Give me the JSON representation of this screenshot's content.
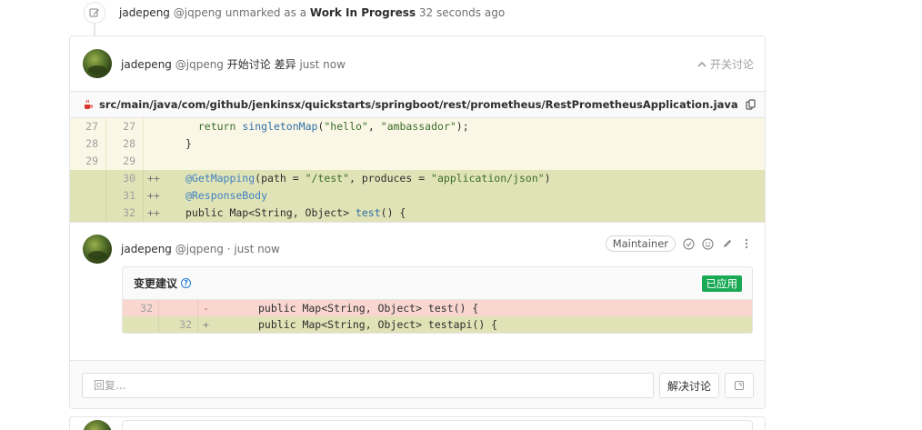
{
  "system_note": {
    "author": "jadepeng",
    "username": "@jqpeng",
    "action": "unmarked as a",
    "status": "Work In Progress",
    "time": "32 seconds ago",
    "icon": "pencil-square-icon"
  },
  "discussion": {
    "author": "jadepeng",
    "username": "@jqpeng",
    "action": "开始讨论",
    "link": "差异",
    "time": "just now",
    "toggle_label": "开关讨论",
    "file_path": "src/main/java/com/github/jenkinsx/quickstarts/springboot/rest/prometheus/RestPrometheusApplication.java",
    "diff_lines": [
      {
        "old": "27",
        "new": "27",
        "marker": "",
        "type": "context",
        "indent": "  ",
        "kw": "return",
        "fn": "singletonMap",
        "open": "(",
        "s1": "\"hello\"",
        "mid": ", ",
        "s2": "\"ambassador\"",
        "close": ");"
      },
      {
        "old": "28",
        "new": "28",
        "marker": "",
        "type": "context",
        "text": "}"
      },
      {
        "old": "29",
        "new": "29",
        "marker": "",
        "type": "context",
        "text": ""
      },
      {
        "old": "",
        "new": "30",
        "marker": "++",
        "type": "add",
        "anno": "@GetMapping",
        "rest_a": "(path = ",
        "s1": "\"/test\"",
        "rest_b": ", produces = ",
        "s2": "\"application/json\"",
        "rest_c": ")"
      },
      {
        "old": "",
        "new": "31",
        "marker": "++",
        "type": "add",
        "anno": "@ResponseBody"
      },
      {
        "old": "",
        "new": "32",
        "marker": "++",
        "type": "add",
        "text_a": "public Map<String, Object> ",
        "fn": "test",
        "text_b": "() {"
      }
    ]
  },
  "reply": {
    "author": "jadepeng",
    "username": "@jqpeng",
    "time": "· just now",
    "role_badge": "Maintainer",
    "suggestion_title": "变更建议",
    "applied_label": "已应用",
    "suggestion_lines": [
      {
        "old": "32",
        "new": "",
        "marker": "-",
        "type": "del",
        "code": "public Map<String, Object> test() {"
      },
      {
        "old": "",
        "new": "32",
        "marker": "+",
        "type": "add",
        "code": "public Map<String, Object> testapi() {"
      }
    ]
  },
  "reply_bar": {
    "placeholder": "回复...",
    "resolve_label": "解决讨论"
  },
  "colors": {
    "diff_add_bg": "#e0e3b6",
    "diff_context_bg": "#fbf7e6",
    "diff_del_bg": "#f9d7d0",
    "applied_green": "#1aaa55",
    "help_blue": "#1f78d1"
  }
}
